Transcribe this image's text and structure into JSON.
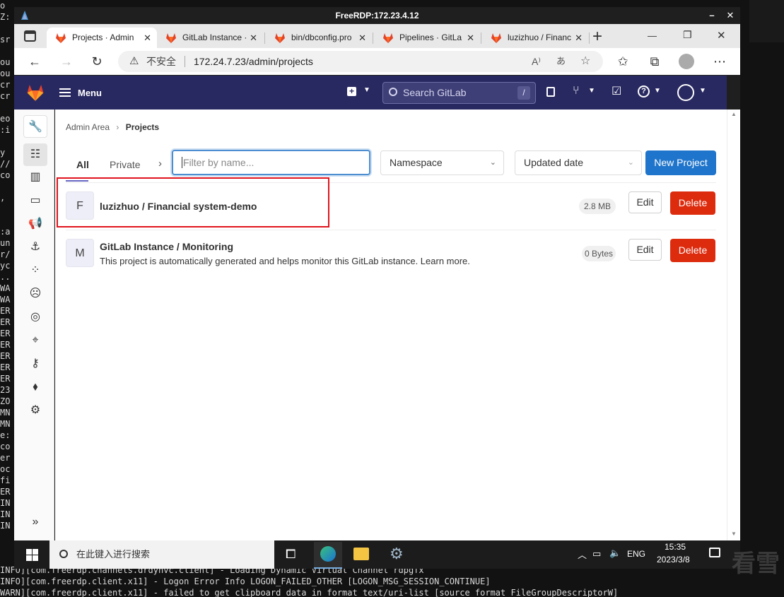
{
  "terminal": {
    "left_fragments": [
      "o",
      "Z: ",
      "",
      "sr",
      "",
      "ou",
      "ou",
      "cr",
      "cr",
      "",
      "eo",
      ":i",
      "",
      "y",
      "//",
      "co",
      "",
      ",",
      "",
      "",
      ":a",
      "un",
      "r/",
      "yc",
      "..",
      "WA",
      "WA",
      "ER",
      "ER",
      "ER",
      "ER",
      "ER",
      "ER",
      "ER",
      "23",
      "ZO",
      "MN",
      "MN",
      "e:",
      "co",
      "er",
      "oc",
      "fi",
      "ER",
      "IN",
      "IN",
      "IN"
    ],
    "bottom_lines": [
      "INFO][com.freerdp.channels.drdynvc.client] - Loading Dynamic Virtual Channel rdpgfx",
      "INFO][com.freerdp.client.x11] - Logon Error Info LOGON_FAILED_OTHER [LOGON_MSG_SESSION_CONTINUE]",
      "WARN][com.freerdp.client.x11] - failed to get clipboard data in format text/uri-list [source format FileGroupDescriptorW]"
    ]
  },
  "rdp_window": {
    "title": "FreeRDP:172.23.4.12",
    "minimize": "–",
    "close": "✕"
  },
  "browser": {
    "tabs": [
      {
        "label": "Projects · Admin",
        "active": true
      },
      {
        "label": "GitLab Instance ·",
        "active": false
      },
      {
        "label": "bin/dbconfig.pro",
        "active": false
      },
      {
        "label": "Pipelines · GitLa",
        "active": false
      },
      {
        "label": "luzizhuo / Financ",
        "active": false
      }
    ],
    "new_tab": "+",
    "window_controls": {
      "minimize": "—",
      "restore": "❐",
      "close": "✕"
    },
    "address": {
      "security_label": "不安全",
      "url": "172.24.7.23/admin/projects",
      "read_aloud": "A⁾",
      "translate": "あ"
    }
  },
  "gitlab": {
    "menu_label": "Menu",
    "search_placeholder": "Search GitLab",
    "search_shortcut": "/",
    "breadcrumb": {
      "parent": "Admin Area",
      "separator": "›",
      "current": "Projects"
    },
    "tabs": {
      "all": "All",
      "private": "Private",
      "more": "›"
    },
    "filter_placeholder": "Filter by name...",
    "namespace_select": "Namespace",
    "sort_select": "Updated date",
    "new_project_label": "New Project",
    "projects": [
      {
        "avatar_letter": "F",
        "name": "luzizhuo / Financial system-demo",
        "description": "",
        "size": "2.8 MB",
        "edit_label": "Edit",
        "delete_label": "Delete"
      },
      {
        "avatar_letter": "M",
        "name": "GitLab Instance / Monitoring",
        "description": "This project is automatically generated and helps monitor this GitLab instance. Learn more.",
        "size": "0 Bytes",
        "edit_label": "Edit",
        "delete_label": "Delete"
      }
    ],
    "sidebar_expand": "»"
  },
  "taskbar": {
    "search_placeholder": "在此键入进行搜索",
    "language": "ENG",
    "time": "15:35",
    "date": "2023/3/8"
  },
  "watermark": "看雪",
  "colors": {
    "gitlab_header": "#292961",
    "new_project_blue": "#1f75cb",
    "delete_red": "#dd2b0e",
    "highlight_box_red": "#e0141e"
  }
}
